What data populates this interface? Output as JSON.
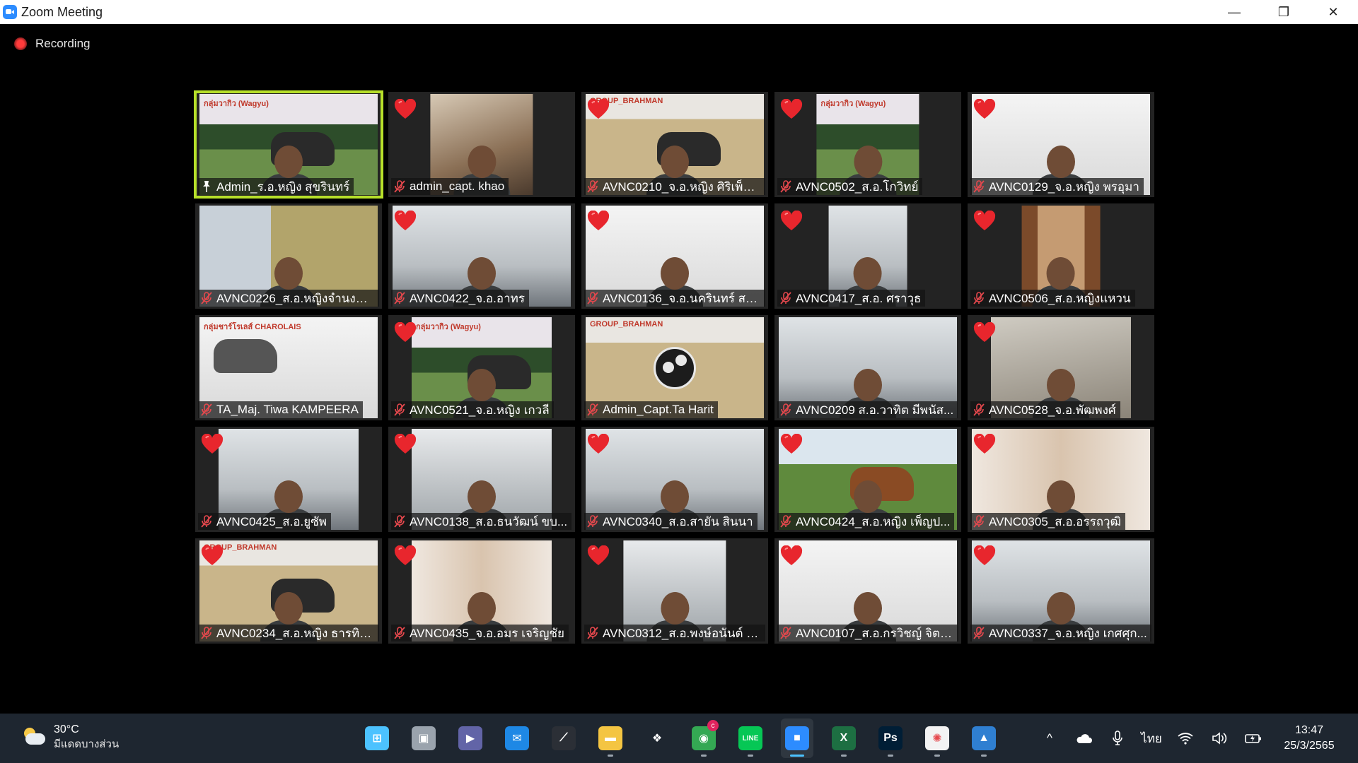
{
  "window": {
    "title": "Zoom Meeting",
    "controls": {
      "minimize": "—",
      "restore": "❐",
      "close": "✕"
    }
  },
  "recording": {
    "label": "Recording"
  },
  "tiles": [
    {
      "name": "Admin_ร.อ.หญิง สุขรินทร์",
      "banner": "กลุ่มวากิว (Wagyu)",
      "reaction": false,
      "pinned": true,
      "active": true
    },
    {
      "name": "admin_capt. khao",
      "banner": "",
      "reaction": true,
      "pinned": false,
      "active": false
    },
    {
      "name": "AVNC0210_จ.อ.หญิง ศิริเพ็ญ ก...",
      "banner": "GROUP_BRAHMAN",
      "reaction": true,
      "pinned": false,
      "active": false
    },
    {
      "name": "AVNC0502_ส.อ.โกวิทย์",
      "banner": "กลุ่มวากิว (Wagyu)",
      "reaction": true,
      "pinned": false,
      "active": false
    },
    {
      "name": "AVNC0129_จ.อ.หญิง พรอุมา",
      "banner": "",
      "reaction": true,
      "pinned": false,
      "active": false
    },
    {
      "name": "AVNC0226_ส.อ.หญิงจำนงค์ ...",
      "banner": "",
      "reaction": false,
      "pinned": false,
      "active": false
    },
    {
      "name": "AVNC0422_จ.อ.อาทร",
      "banner": "",
      "reaction": true,
      "pinned": false,
      "active": false
    },
    {
      "name": "AVNC0136_จ.อ.นครินทร์ สมิ...",
      "banner": "",
      "reaction": true,
      "pinned": false,
      "active": false
    },
    {
      "name": "AVNC0417_ส.อ. ศราวุธ",
      "banner": "",
      "reaction": true,
      "pinned": false,
      "active": false
    },
    {
      "name": "AVNC0506_ส.อ.หญิงแหวน",
      "banner": "",
      "reaction": true,
      "pinned": false,
      "active": false
    },
    {
      "name": "TA_Maj. Tiwa KAMPEERA",
      "banner": "กลุ่มชาร์โรเลส์ CHAROLAIS",
      "reaction": false,
      "pinned": false,
      "active": false
    },
    {
      "name": "AVNC0521_จ.อ.หญิง เกวลี",
      "banner": "กลุ่มวากิว (Wagyu)",
      "reaction": true,
      "pinned": false,
      "active": false
    },
    {
      "name": "Admin_Capt.Ta Harit",
      "banner": "GROUP_BRAHMAN",
      "reaction": false,
      "pinned": false,
      "active": false
    },
    {
      "name": "AVNC0209 ส.อ.วาทิต มีพนัส...",
      "banner": "",
      "reaction": false,
      "pinned": false,
      "active": false
    },
    {
      "name": "AVNC0528_จ.อ.พัฒพงศ์",
      "banner": "",
      "reaction": true,
      "pinned": false,
      "active": false
    },
    {
      "name": "AVNC0425_ส.อ.ยูซัพ",
      "banner": "",
      "reaction": true,
      "pinned": false,
      "active": false
    },
    {
      "name": "AVNC0138_ส.อ.ธนวัฒน์ ขบ...",
      "banner": "",
      "reaction": true,
      "pinned": false,
      "active": false
    },
    {
      "name": "AVNC0340_ส.อ.สายัน สินนา",
      "banner": "",
      "reaction": true,
      "pinned": false,
      "active": false
    },
    {
      "name": "AVNC0424_ส.อ.หญิง เพ็ญป...",
      "banner": "",
      "reaction": true,
      "pinned": false,
      "active": false
    },
    {
      "name": "AVNC0305_ส.อ.อรรถวุฒิ",
      "banner": "",
      "reaction": true,
      "pinned": false,
      "active": false
    },
    {
      "name": "AVNC0234_ส.อ.หญิง ธารทิพ...",
      "banner": "GROUP_BRAHMAN",
      "reaction": true,
      "pinned": false,
      "active": false
    },
    {
      "name": "AVNC0435_จ.อ.อมร เจริญชัย",
      "banner": "",
      "reaction": true,
      "pinned": false,
      "active": false
    },
    {
      "name": "AVNC0312_ส.อ.พงษ์อนันต์ อ...",
      "banner": "",
      "reaction": true,
      "pinned": false,
      "active": false
    },
    {
      "name": "AVNC0107_ส.อ.กรวิชญ์ จิตโ...",
      "banner": "",
      "reaction": true,
      "pinned": false,
      "active": false
    },
    {
      "name": "AVNC0337_จ.อ.หญิง เกศศุก...",
      "banner": "",
      "reaction": true,
      "pinned": false,
      "active": false
    }
  ],
  "taskbar": {
    "weather": {
      "temp": "30°C",
      "condition": "มีแดดบางส่วน"
    },
    "apps": [
      {
        "name": "start",
        "icon": "windows-icon",
        "color": "#4cc2ff",
        "glyph": "⊞",
        "current": false,
        "running": false
      },
      {
        "name": "task-view",
        "icon": "task-view-icon",
        "color": "#9aa3ad",
        "glyph": "▣",
        "current": false,
        "running": false
      },
      {
        "name": "teams-chat",
        "icon": "chat-icon",
        "color": "#6264a7",
        "glyph": "▶",
        "current": false,
        "running": false
      },
      {
        "name": "mail",
        "icon": "mail-icon",
        "color": "#1e88e5",
        "glyph": "✉",
        "current": false,
        "running": false
      },
      {
        "name": "app-slash",
        "icon": "slash-app-icon",
        "color": "#2b2f36",
        "glyph": "⟋",
        "current": false,
        "running": false
      },
      {
        "name": "file-explorer",
        "icon": "folder-icon",
        "color": "#f4c542",
        "glyph": "▬",
        "current": false,
        "running": true
      },
      {
        "name": "dropbox",
        "icon": "dropbox-icon",
        "color": "#1e2630",
        "glyph": "❖",
        "current": false,
        "running": false
      },
      {
        "name": "chrome",
        "icon": "chrome-icon",
        "color": "#34a853",
        "glyph": "◉",
        "current": false,
        "running": true,
        "badge": "c"
      },
      {
        "name": "line",
        "icon": "line-icon",
        "color": "#06c755",
        "glyph": "LINE",
        "current": false,
        "running": true
      },
      {
        "name": "zoom",
        "icon": "zoom-icon",
        "color": "#2d8cff",
        "glyph": "■",
        "current": true,
        "running": true
      },
      {
        "name": "excel",
        "icon": "excel-icon",
        "color": "#1d6f42",
        "glyph": "X",
        "current": false,
        "running": true
      },
      {
        "name": "photoshop",
        "icon": "photoshop-icon",
        "color": "#001e36",
        "glyph": "Ps",
        "current": false,
        "running": true
      },
      {
        "name": "picasa",
        "icon": "pinwheel-icon",
        "color": "#f3f3f3",
        "glyph": "✺",
        "current": false,
        "running": true
      },
      {
        "name": "photos",
        "icon": "photos-icon",
        "color": "#2f7fd1",
        "glyph": "▲",
        "current": false,
        "running": true
      }
    ],
    "tray": {
      "chevron": "^",
      "language": "ไทย",
      "time": "13:47",
      "date": "25/3/2565"
    }
  }
}
